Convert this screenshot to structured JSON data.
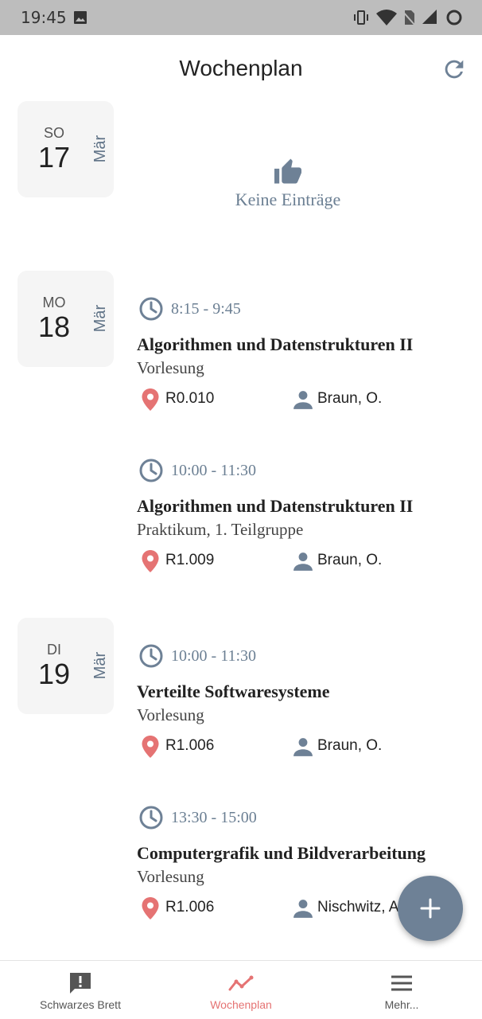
{
  "status_bar": {
    "time": "19:45"
  },
  "header": {
    "title": "Wochenplan"
  },
  "days": [
    {
      "dow": "SO",
      "day": "17",
      "month": "Mär",
      "empty_text": "Keine Einträge"
    },
    {
      "dow": "MO",
      "day": "18",
      "month": "Mär"
    },
    {
      "dow": "DI",
      "day": "19",
      "month": "Mär"
    }
  ],
  "entries": [
    {
      "time": "8:15 - 9:45",
      "course": "Algorithmen und Datenstrukturen II",
      "type": "Vorlesung",
      "room": "R0.010",
      "person": "Braun, O."
    },
    {
      "time": "10:00 - 11:30",
      "course": "Algorithmen und Datenstrukturen II",
      "type": "Praktikum, 1. Teilgruppe",
      "room": "R1.009",
      "person": "Braun, O."
    },
    {
      "time": "10:00 - 11:30",
      "course": "Verteilte Softwaresysteme",
      "type": "Vorlesung",
      "room": "R1.006",
      "person": "Braun, O."
    },
    {
      "time": "13:30 - 15:00",
      "course": "Computergrafik und Bildverarbeitung",
      "type": "Vorlesung",
      "room": "R1.006",
      "person": "Nischwitz, A."
    }
  ],
  "bottom_nav": [
    {
      "label": "Schwarzes Brett",
      "icon": "alert-message-icon",
      "active": false
    },
    {
      "label": "Wochenplan",
      "icon": "trend-line-icon",
      "active": true
    },
    {
      "label": "Mehr...",
      "icon": "menu-icon",
      "active": false
    }
  ],
  "colors": {
    "accent": "#e57373",
    "slate": "#6e8196",
    "date_card_bg": "#f5f5f5",
    "status_bar": "#bdbdbd"
  }
}
